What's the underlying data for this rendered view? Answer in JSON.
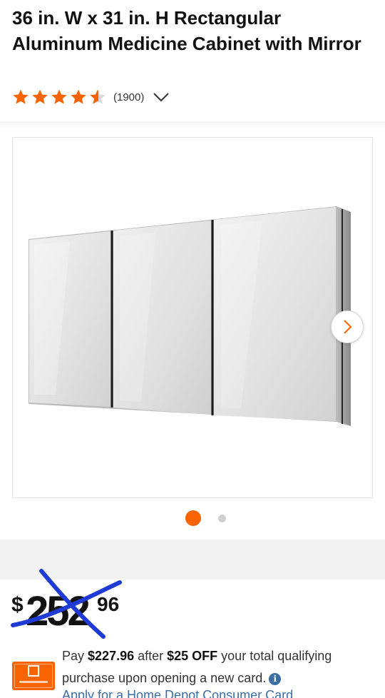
{
  "product": {
    "title": "36 in. W x 31 in. H Rectangular Aluminum Medicine Cabinet with Mirror",
    "rating": 4.5,
    "review_count": "(1900)"
  },
  "gallery": {
    "image_icon": "medicine-cabinet-image",
    "next_icon": "chevron-right-icon",
    "active_index": 0,
    "total_images": 2
  },
  "price": {
    "currency": "$",
    "dollars": "252",
    "cents": "96"
  },
  "promo": {
    "pay_prefix": "Pay ",
    "pay_amount": "$227.96",
    "after": " after ",
    "discount": "$25 OFF",
    "rest": " your total qualifying purchase upon opening a new card.",
    "info_icon": "info-icon",
    "apply_link": "Apply for a Home Depot Consumer Card"
  },
  "colors": {
    "accent": "#f96302",
    "link": "#3a6ea5",
    "scribble": "#1f3bd6",
    "star": "#f96302"
  }
}
